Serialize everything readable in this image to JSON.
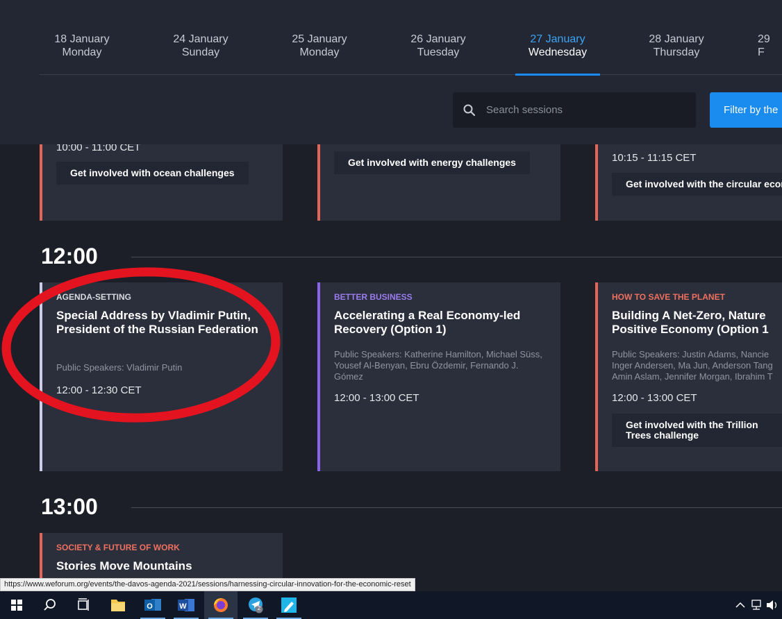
{
  "date_tabs": [
    {
      "date": "18 January",
      "weekday": "Monday"
    },
    {
      "date": "24 January",
      "weekday": "Sunday"
    },
    {
      "date": "25 January",
      "weekday": "Monday"
    },
    {
      "date": "26 January",
      "weekday": "Tuesday"
    },
    {
      "date": "27 January",
      "weekday": "Wednesday",
      "active": true
    },
    {
      "date": "28 January",
      "weekday": "Thursday"
    },
    {
      "date": "29",
      "weekday": "F"
    }
  ],
  "search": {
    "placeholder": "Search sessions"
  },
  "filter_button": {
    "label": "Filter by the"
  },
  "top_row": [
    {
      "time": "10:00 - 11:00 CET",
      "chip": "Get involved with ocean challenges",
      "accent": "#e0665a"
    },
    {
      "chip": "Get involved with energy challenges",
      "accent": "#e0665a"
    },
    {
      "time": "10:15 - 11:15 CET",
      "chip": "Get involved with the circular econ",
      "accent": "#e0665a"
    }
  ],
  "hour_12": "12:00",
  "sessions_12": [
    {
      "category": "AGENDA-SETTING",
      "category_color": "#d8dae0",
      "accent": "#c9cde8",
      "title": "Special Address by Vladimir Putin, President of the Russian Federation",
      "speakers": "Public Speakers: Vladimir Putin",
      "time": "12:00 - 12:30 CET"
    },
    {
      "category": "BETTER BUSINESS",
      "category_color": "#9b7cf0",
      "accent": "#8a63e8",
      "title": "Accelerating a Real Economy-led Recovery (Option 1)",
      "speakers": "Public Speakers: Katherine Hamilton, Michael Süss, Yousef Al-Benyan, Ebru Özdemir, Fernando J. Gómez",
      "time": "12:00 - 13:00 CET"
    },
    {
      "category": "HOW TO SAVE THE PLANET",
      "category_color": "#f0705f",
      "accent": "#e0665a",
      "title": "Building A Net-Zero, Nature Positive Economy (Option 1",
      "speakers": "Public Speakers: Justin Adams, Nancie Inger Andersen, Ma Jun, Anderson Tang Amin Aslam, Jennifer Morgan, Ibrahim T",
      "time": "12:00 - 13:00 CET",
      "chip": "Get involved with the Trillion Trees challenge"
    }
  ],
  "hour_13": "13:00",
  "sessions_13": [
    {
      "category": "SOCIETY & FUTURE OF WORK",
      "category_color": "#f0705f",
      "accent": "#e0665a",
      "title": "Stories Move Mountains"
    }
  ],
  "status_url": "https://www.weforum.org/events/the-davos-agenda-2021/sessions/harnessing-circular-innovation-for-the-economic-reset",
  "taskbar": {
    "apps": [
      "windows-start-icon",
      "search-icon",
      "task-view-icon",
      "file-explorer-icon",
      "outlook-icon",
      "word-icon",
      "firefox-icon",
      "telegram-icon",
      "paint-icon"
    ],
    "telegram_badge": "2"
  },
  "annotation_color": "#e3141f"
}
